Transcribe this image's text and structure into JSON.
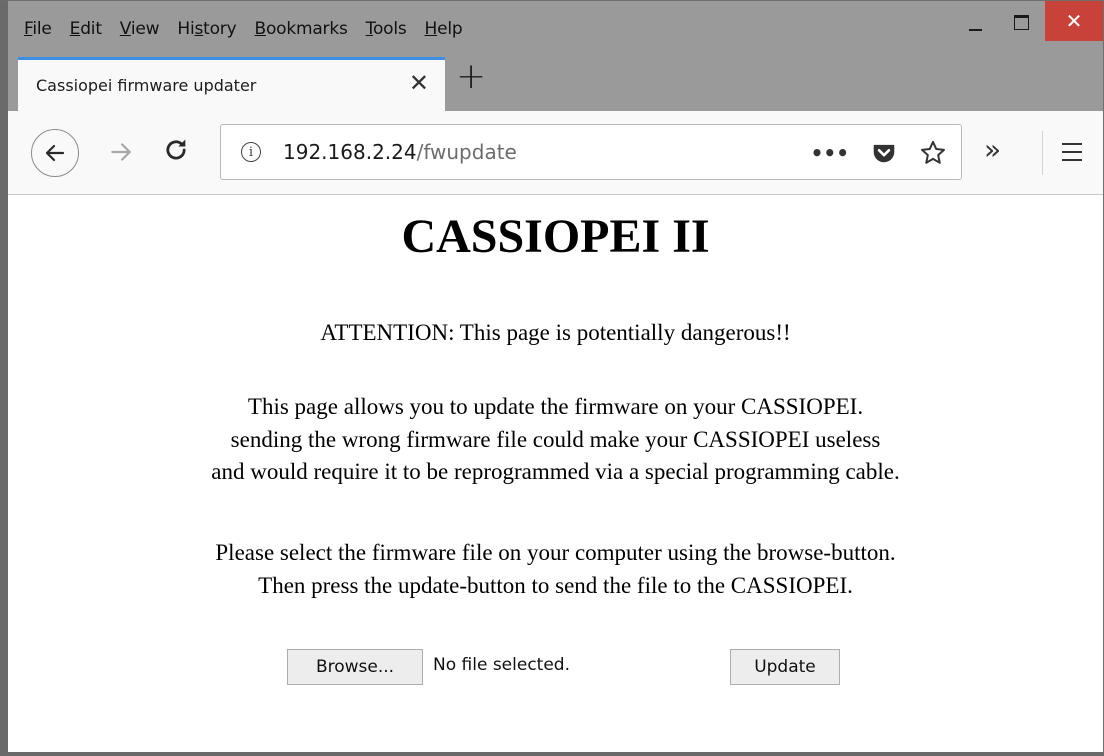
{
  "menubar": {
    "items": [
      {
        "label": "File",
        "underline": "F",
        "rest": "ile"
      },
      {
        "label": "Edit",
        "underline": "E",
        "rest": "dit"
      },
      {
        "label": "View",
        "underline": "V",
        "rest": "iew"
      },
      {
        "label": "History",
        "pre": "Hi",
        "underline": "s",
        "rest": "tory"
      },
      {
        "label": "Bookmarks",
        "underline": "B",
        "rest": "ookmarks"
      },
      {
        "label": "Tools",
        "underline": "T",
        "rest": "ools"
      },
      {
        "label": "Help",
        "underline": "H",
        "rest": "elp"
      }
    ],
    "close_glyph": "✕",
    "close_color": "#c9423a"
  },
  "tabs": [
    {
      "title": "Cassiopei firmware updater",
      "active": true,
      "close_glyph": "✕"
    }
  ],
  "new_tab_glyph": "+",
  "navbar": {
    "url_host": "192.168.2.24",
    "url_path": "/fwupdate",
    "info_glyph": "i",
    "more_glyph": "•••",
    "overflow_glyph": "»",
    "icons": [
      "back-arrow-icon",
      "forward-arrow-icon",
      "reload-icon",
      "info-icon",
      "page-actions-icon",
      "pocket-icon",
      "bookmark-star-icon",
      "overflow-icon",
      "hamburger-menu-icon"
    ]
  },
  "page": {
    "title": "CASSIOPEI II",
    "warning": "ATTENTION: This page is potentially dangerous!!",
    "info_lines": [
      "This page allows you to update the firmware on your CASSIOPEI.",
      "sending the wrong firmware file could make your CASSIOPEI useless",
      "and would require it to be reprogrammed via a special programming cable."
    ],
    "instruction_lines": [
      "Please select the firmware file on your computer using the browse-button.",
      "Then press the update-button to send the file to the CASSIOPEI."
    ],
    "browse_label": "Browse...",
    "file_status": "No file selected.",
    "update_label": "Update"
  },
  "colors": {
    "chrome_gray": "#9a9a9a",
    "active_tab_accent": "#3c8ee6",
    "close_red": "#c9423a"
  }
}
